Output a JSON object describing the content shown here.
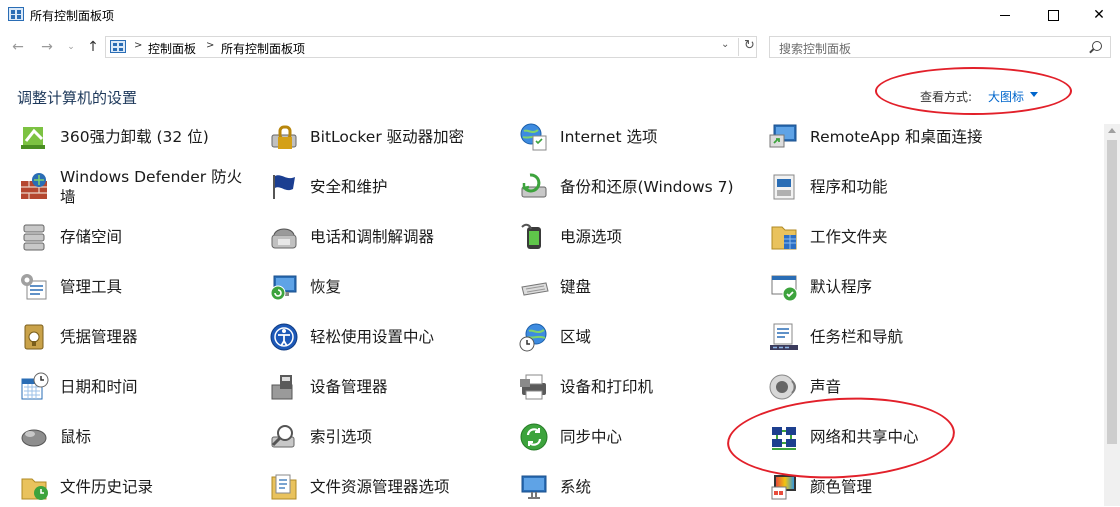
{
  "window": {
    "title": "所有控制面板项",
    "close_glyph": "✕"
  },
  "nav": {
    "back": "←",
    "forward": "→",
    "recent": "⌄",
    "up": "↑"
  },
  "breadcrumb": {
    "items": [
      "控制面板",
      "所有控制面板项"
    ],
    "sep": ">",
    "dropdown": "⌄",
    "refresh": "↻"
  },
  "search": {
    "placeholder": "搜索控制面板"
  },
  "header": {
    "title": "调整计算机的设置",
    "view_label": "查看方式:",
    "view_value": "大图标"
  },
  "icons": {
    "accent": "#2a6db5",
    "green": "#3da33d",
    "annotation": "#e2202a"
  },
  "items": [
    [
      {
        "label": "360强力卸载 (32 位)",
        "icon": "uninstall-icon"
      },
      {
        "label": "Windows Defender 防火墙",
        "icon": "firewall-icon"
      },
      {
        "label": "存储空间",
        "icon": "storage-icon"
      },
      {
        "label": "管理工具",
        "icon": "admin-tools-icon"
      },
      {
        "label": "凭据管理器",
        "icon": "credential-icon"
      },
      {
        "label": "日期和时间",
        "icon": "calendar-icon"
      },
      {
        "label": "鼠标",
        "icon": "mouse-icon"
      },
      {
        "label": "文件历史记录",
        "icon": "file-history-icon"
      }
    ],
    [
      {
        "label": "BitLocker 驱动器加密",
        "icon": "bitlocker-icon"
      },
      {
        "label": "安全和维护",
        "icon": "flag-icon"
      },
      {
        "label": "电话和调制解调器",
        "icon": "phone-icon"
      },
      {
        "label": "恢复",
        "icon": "recovery-icon"
      },
      {
        "label": "轻松使用设置中心",
        "icon": "ease-of-access-icon"
      },
      {
        "label": "设备管理器",
        "icon": "device-manager-icon"
      },
      {
        "label": "索引选项",
        "icon": "indexing-icon"
      },
      {
        "label": "文件资源管理器选项",
        "icon": "folder-options-icon"
      }
    ],
    [
      {
        "label": "Internet 选项",
        "icon": "internet-icon"
      },
      {
        "label": "备份和还原(Windows 7)",
        "icon": "backup-icon"
      },
      {
        "label": "电源选项",
        "icon": "power-icon"
      },
      {
        "label": "键盘",
        "icon": "keyboard-icon"
      },
      {
        "label": "区域",
        "icon": "region-icon"
      },
      {
        "label": "设备和打印机",
        "icon": "printer-icon"
      },
      {
        "label": "同步中心",
        "icon": "sync-icon"
      },
      {
        "label": "系统",
        "icon": "system-icon"
      }
    ],
    [
      {
        "label": "RemoteApp 和桌面连接",
        "icon": "remoteapp-icon"
      },
      {
        "label": "程序和功能",
        "icon": "programs-icon"
      },
      {
        "label": "工作文件夹",
        "icon": "work-folders-icon"
      },
      {
        "label": "默认程序",
        "icon": "default-programs-icon"
      },
      {
        "label": "任务栏和导航",
        "icon": "taskbar-icon"
      },
      {
        "label": "声音",
        "icon": "sound-icon"
      },
      {
        "label": "网络和共享中心",
        "icon": "network-icon"
      },
      {
        "label": "颜色管理",
        "icon": "color-management-icon"
      }
    ]
  ]
}
